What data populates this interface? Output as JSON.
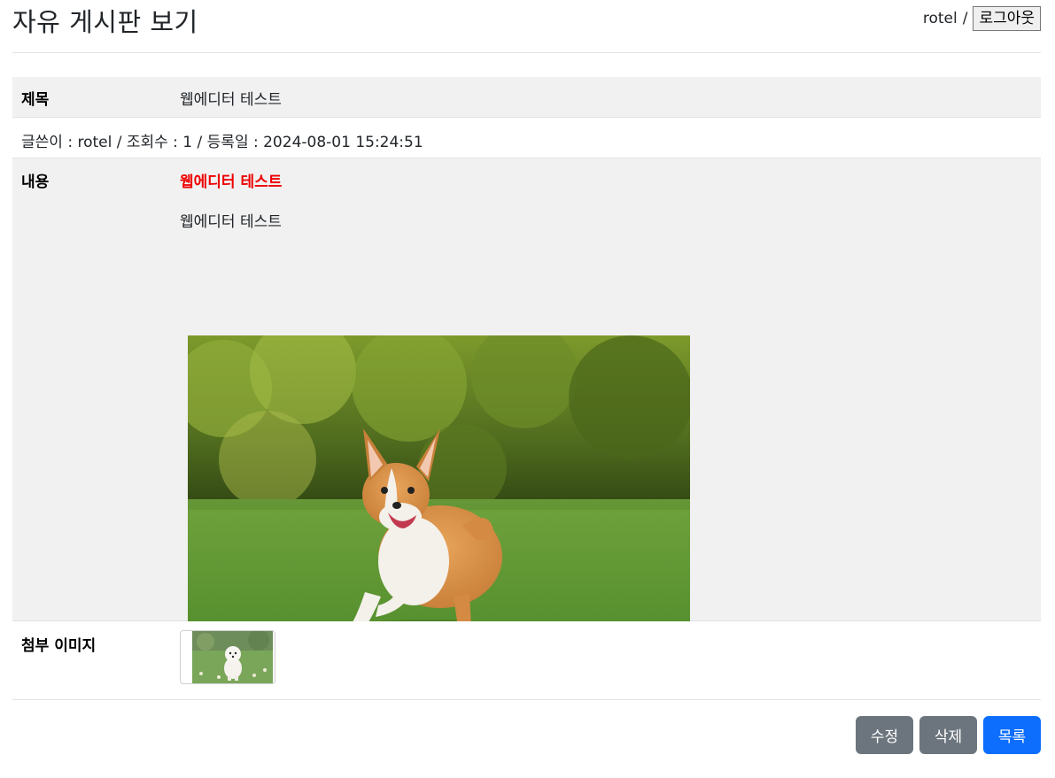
{
  "header": {
    "title": "자유 게시판 보기",
    "username": "rotel",
    "separator": "/",
    "logout_label": "로그아웃"
  },
  "post": {
    "title_label": "제목",
    "title_value": "웹에디터 테스트",
    "meta": "글쓴이 : rotel / 조회수 : 1 / 등록일 : 2024-08-01 15:24:51",
    "content_label": "내용",
    "content_heading": "웹에디터 테스트",
    "content_paragraph": "웹에디터 테스트",
    "attach_label": "첨부 이미지"
  },
  "actions": {
    "edit_label": "수정",
    "delete_label": "삭제",
    "list_label": "목록"
  },
  "colors": {
    "heading_red": "#ee0000",
    "button_gray": "#6c757d",
    "button_blue": "#0d6efd",
    "row_gray": "#f1f1f1"
  }
}
